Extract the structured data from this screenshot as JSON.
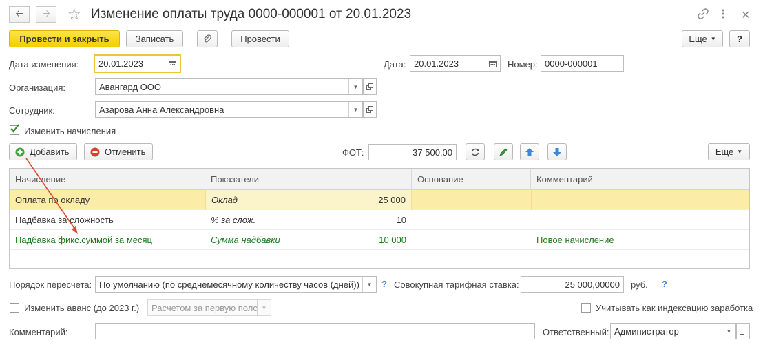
{
  "window": {
    "title": "Изменение оплаты труда 0000-000001 от 20.01.2023"
  },
  "toolbar": {
    "post_close_label": "Провести и закрыть",
    "save_label": "Записать",
    "post_label": "Провести",
    "more_label": "Еще",
    "help_label": "?"
  },
  "form": {
    "change_date_label": "Дата изменения:",
    "change_date_value": "20.01.2023",
    "date_label": "Дата:",
    "date_value": "20.01.2023",
    "number_label": "Номер:",
    "number_value": "0000-000001",
    "org_label": "Организация:",
    "org_value": "Авангард ООО",
    "employee_label": "Сотрудник:",
    "employee_value": "Азарова Анна Александровна",
    "change_accruals_label": "Изменить начисления",
    "change_accruals_checked": true
  },
  "accruals_toolbar": {
    "add_label": "Добавить",
    "cancel_label": "Отменить",
    "fot_label": "ФОТ:",
    "fot_value": "37 500,00",
    "more_label": "Еще"
  },
  "table": {
    "headers": [
      "Начисление",
      "Показатели",
      "Основание",
      "Комментарий"
    ],
    "rows": [
      {
        "accrual": "Оплата по окладу",
        "indicator": "Оклад",
        "value": "25 000",
        "basis": "",
        "comment": "",
        "selected": true,
        "green": false
      },
      {
        "accrual": "Надбавка за сложность",
        "indicator": "% за слож.",
        "value": "10",
        "basis": "",
        "comment": "",
        "selected": false,
        "green": false
      },
      {
        "accrual": "Надбавка фикс.суммой за месяц",
        "indicator": "Сумма надбавки",
        "value": "10 000",
        "basis": "",
        "comment": "Новое начисление",
        "selected": false,
        "green": true
      }
    ]
  },
  "bottom": {
    "recalc_label": "Порядок пересчета:",
    "recalc_value": "По умолчанию (по среднемесячному количеству часов (дней))",
    "help_q": "?",
    "total_rate_label": "Совокупная тарифная ставка:",
    "total_rate_value": "25 000,00000",
    "currency": "руб.",
    "advance_label": "Изменить аванс (до 2023 г.)",
    "advance_checked": false,
    "advance_method": "Расчетом за первую полс",
    "indexation_label": "Учитывать как индексацию заработка",
    "indexation_checked": false,
    "comment_label": "Комментарий:",
    "comment_value": "",
    "responsible_label": "Ответственный:",
    "responsible_value": "Администратор"
  },
  "colors": {
    "primary_button": "#f3ce00",
    "selected_row": "#fbeca7",
    "new_accrual_text": "#1f7a1f",
    "arrow": "#e0452e"
  }
}
